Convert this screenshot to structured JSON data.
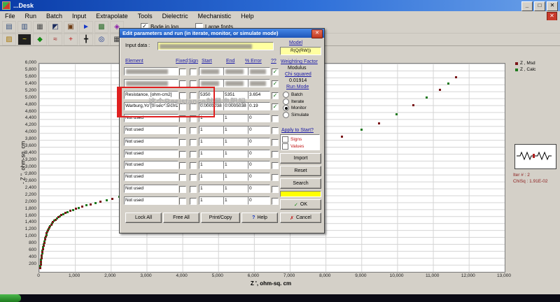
{
  "window": {
    "title": "...Desk",
    "controls": {
      "minimize": "_",
      "maximize": "□",
      "close": "✕",
      "mdi_close": "✕"
    }
  },
  "menu": {
    "items": [
      "File",
      "Run",
      "Batch",
      "Input",
      "Extrapolate",
      "Tools",
      "Dielectric",
      "Mechanistic",
      "Help"
    ]
  },
  "toolbar": {
    "checkbox_bode": {
      "label": "Bode in log",
      "checked": true
    },
    "checkbox_fonts": {
      "label": "Large fonts",
      "checked": false
    },
    "row1_icons": [
      {
        "name": "new-report-icon",
        "glyph": "▤",
        "color": "#35507e"
      },
      {
        "name": "open-report-icon",
        "glyph": "▥",
        "color": "#35507e"
      },
      {
        "name": "print-icon",
        "glyph": "▦",
        "color": "#4c4c4c"
      },
      {
        "name": "users-icon",
        "glyph": "◩",
        "color": "#1c2c5e"
      },
      {
        "name": "database-icon",
        "glyph": "▣",
        "color": "#6e3c14"
      },
      {
        "name": "run-arrow-icon",
        "glyph": "►",
        "color": "#1436c8"
      },
      {
        "name": "stack-icon",
        "glyph": "▩",
        "color": "#2c6e2c"
      },
      {
        "name": "info-icon",
        "glyph": "◈",
        "color": "#8c1ca8"
      }
    ],
    "row2_icons": [
      {
        "name": "open-folder-icon",
        "glyph": "▨",
        "color": "#a87808"
      },
      {
        "name": "waveform-icon",
        "glyph": "~",
        "color": "#f0e020",
        "bg": "#202020"
      },
      {
        "name": "spectrum-icon",
        "glyph": "◆",
        "color": "#138a13"
      },
      {
        "name": "circuit-fit-icon",
        "glyph": "≈",
        "color": "#a01818"
      },
      {
        "name": "add-element-icon",
        "glyph": "+",
        "color": "#c01010"
      },
      {
        "name": "move-icon",
        "glyph": "╋",
        "color": "#101010"
      },
      {
        "name": "zoom-icon",
        "glyph": "◎",
        "color": "#10308c"
      },
      {
        "name": "grid-icon",
        "glyph": "▦",
        "color": "#3c3c3c"
      },
      {
        "name": "axes-icon",
        "glyph": "∟",
        "color": "#000000"
      },
      {
        "name": "marker-icon",
        "glyph": "●",
        "color": "#8c1010"
      }
    ]
  },
  "dialog": {
    "title": "Edit parameters and run (in iterate, monitor, or simulate mode)",
    "input_data_label": "Input data :",
    "input_data_value": "",
    "headers": [
      "Element",
      "Fixed",
      "Sign",
      "Start",
      "End",
      "% Error",
      "??"
    ],
    "rows": [
      {
        "element": "",
        "start": "",
        "end": "",
        "error": "",
        "include": true,
        "redacted": true
      },
      {
        "element": "",
        "start": "",
        "end": "",
        "error": "",
        "include": true,
        "redacted": true
      },
      {
        "element": "Resistance,    [ohm-cm2]",
        "start": "5350",
        "end": "5351",
        "error": "3.654",
        "include": true,
        "redacted": false
      },
      {
        "element": "Warburg,Yo [S-sec^.5/cm2]",
        "start": "0.0005038",
        "end": "0.0005038",
        "error": "0.19",
        "include": true,
        "redacted": false
      },
      {
        "element": "Not used",
        "start": "1",
        "end": "1",
        "error": "0",
        "include": false,
        "redacted": false
      },
      {
        "element": "Not used",
        "start": "1",
        "end": "1",
        "error": "0",
        "include": false,
        "redacted": false
      },
      {
        "element": "Not used",
        "start": "1",
        "end": "1",
        "error": "0",
        "include": false,
        "redacted": false
      },
      {
        "element": "Not used",
        "start": "1",
        "end": "1",
        "error": "0",
        "include": false,
        "redacted": false
      },
      {
        "element": "Not used",
        "start": "1",
        "end": "1",
        "error": "0",
        "include": false,
        "redacted": false
      },
      {
        "element": "Not used",
        "start": "1",
        "end": "1",
        "error": "0",
        "include": false,
        "redacted": false
      },
      {
        "element": "Not used",
        "start": "1",
        "end": "1",
        "error": "0",
        "include": false,
        "redacted": false
      },
      {
        "element": "Not used",
        "start": "1",
        "end": "1",
        "error": "0",
        "include": false,
        "redacted": false
      }
    ],
    "model_label": "Model",
    "model_value": "R(Q(RW))",
    "weighting_label": "Weighting Factor",
    "weighting_value": "Modulus",
    "chi_label": "Chi squared",
    "chi_value": "0.01914",
    "run_mode_label": "Run Mode",
    "run_modes": [
      "Batch",
      "Iterate",
      "Monitor",
      "Simulate"
    ],
    "run_mode_selected": "Monitor",
    "apply_link": "Apply to Start?",
    "signs_label": "Signs",
    "values_label": "Values",
    "buttons": {
      "import": "Import",
      "reset": "Reset",
      "search": "Search",
      "ok": "OK",
      "cancel": "Cancel",
      "help": "Help",
      "lock": "Lock All",
      "free": "Free All",
      "print": "Print/Copy"
    }
  },
  "annotation": {
    "text": "这个Resistance就是电阻吗"
  },
  "status": {
    "iter": "Iter # :  2",
    "chisq": "ChiSq :  1.91E-02"
  },
  "chart_data": {
    "type": "scatter",
    "title": "",
    "xlabel": "Z ',  ohm-sq. cm",
    "ylabel": "- Z '',  ohm-sq. cm",
    "xlim": [
      0,
      13000
    ],
    "ylim": [
      0,
      6000
    ],
    "xtick_step": 1000,
    "ytick_step": 200,
    "grid": true,
    "legend_position": "top-right",
    "series": [
      {
        "name": "Z , Msd",
        "color": "#7a1518",
        "marker": "square",
        "points": [
          [
            30,
            120
          ],
          [
            40,
            210
          ],
          [
            50,
            300
          ],
          [
            62,
            390
          ],
          [
            74,
            480
          ],
          [
            88,
            570
          ],
          [
            103,
            660
          ],
          [
            120,
            750
          ],
          [
            139,
            840
          ],
          [
            161,
            930
          ],
          [
            186,
            1020
          ],
          [
            215,
            1110
          ],
          [
            249,
            1200
          ],
          [
            288,
            1285
          ],
          [
            334,
            1365
          ],
          [
            388,
            1440
          ],
          [
            452,
            1510
          ],
          [
            528,
            1575
          ],
          [
            620,
            1640
          ],
          [
            730,
            1700
          ],
          [
            862,
            1760
          ],
          [
            1020,
            1820
          ],
          [
            1210,
            1882
          ],
          [
            1440,
            1948
          ],
          [
            1715,
            2022
          ],
          [
            2045,
            2108
          ],
          [
            2440,
            2212
          ],
          [
            2915,
            2340
          ],
          [
            3485,
            2495
          ],
          [
            4170,
            2685
          ],
          [
            4990,
            2915
          ],
          [
            5975,
            3190
          ],
          [
            7155,
            3520
          ],
          [
            8450,
            3900
          ],
          [
            9500,
            4280
          ],
          [
            10450,
            4800
          ],
          [
            11200,
            5250
          ],
          [
            11650,
            5600
          ]
        ]
      },
      {
        "name": "Z , Calc",
        "color": "#1e7a1e",
        "marker": "square",
        "points": [
          [
            35,
            165
          ],
          [
            45,
            255
          ],
          [
            56,
            345
          ],
          [
            68,
            435
          ],
          [
            81,
            525
          ],
          [
            95,
            615
          ],
          [
            111,
            705
          ],
          [
            129,
            795
          ],
          [
            150,
            885
          ],
          [
            173,
            975
          ],
          [
            200,
            1065
          ],
          [
            232,
            1155
          ],
          [
            268,
            1242
          ],
          [
            310,
            1325
          ],
          [
            360,
            1402
          ],
          [
            419,
            1475
          ],
          [
            489,
            1542
          ],
          [
            573,
            1607
          ],
          [
            674,
            1670
          ],
          [
            795,
            1730
          ],
          [
            940,
            1790
          ],
          [
            1113,
            1851
          ],
          [
            1323,
            1915
          ],
          [
            1576,
            1985
          ],
          [
            1878,
            2065
          ],
          [
            2240,
            2160
          ],
          [
            2675,
            2275
          ],
          [
            3197,
            2415
          ],
          [
            3824,
            2590
          ],
          [
            4577,
            2800
          ],
          [
            5479,
            3050
          ],
          [
            6562,
            3350
          ],
          [
            7860,
            3710
          ],
          [
            9000,
            4090
          ],
          [
            9970,
            4540
          ],
          [
            10820,
            5020
          ],
          [
            11420,
            5420
          ]
        ]
      }
    ]
  }
}
